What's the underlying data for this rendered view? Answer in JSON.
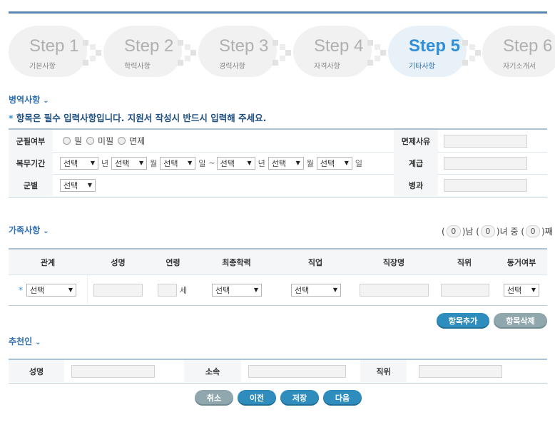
{
  "steps": [
    {
      "title": "Step 1",
      "sub": "기본사항"
    },
    {
      "title": "Step 2",
      "sub": "학력사항"
    },
    {
      "title": "Step 3",
      "sub": "경력사항"
    },
    {
      "title": "Step 4",
      "sub": "자격사항"
    },
    {
      "title": "Step 5",
      "sub": "기타사항",
      "active": true
    },
    {
      "title": "Step 6",
      "sub": "자기소개서"
    }
  ],
  "military": {
    "section_title": "병역사항",
    "required_note": "항목은 필수 입력사항입니다. 지원서 작성시 반드시 입력해 주세요.",
    "required_star": "*",
    "labels": {
      "status": "군필여부",
      "exempt_reason": "면제사유",
      "period": "복무기간",
      "rank": "계급",
      "branch": "군별",
      "specialty": "병과"
    },
    "status_options": [
      "필",
      "미필",
      "면제"
    ],
    "select_placeholder": "선택",
    "units": {
      "year": "년",
      "month": "월",
      "day": "일",
      "tilde": "~"
    }
  },
  "family": {
    "section_title": "가족사항",
    "count_labels": {
      "male": "남",
      "female": "녀",
      "middle": "중",
      "nth": "째"
    },
    "count_values": {
      "male": "0",
      "female": "0",
      "nth": "0"
    },
    "headers": [
      "관계",
      "성명",
      "연령",
      "최종학력",
      "직업",
      "직장명",
      "직위",
      "동거여부"
    ],
    "row": {
      "star": "*",
      "relation": "선택",
      "age_unit": "세",
      "education": "선택",
      "job": "선택",
      "cohabit": "선택"
    },
    "add_button": "항목추가",
    "delete_button": "항목삭제"
  },
  "referrer": {
    "section_title": "추천인",
    "labels": {
      "name": "성명",
      "affiliation": "소속",
      "position": "직위"
    }
  },
  "actions": {
    "cancel": "취소",
    "prev": "이전",
    "save": "저장",
    "next": "다음"
  },
  "colors": {
    "accent": "#2e8dbd",
    "step_active": "#2f8fd8",
    "section": "#2f6fb1"
  }
}
